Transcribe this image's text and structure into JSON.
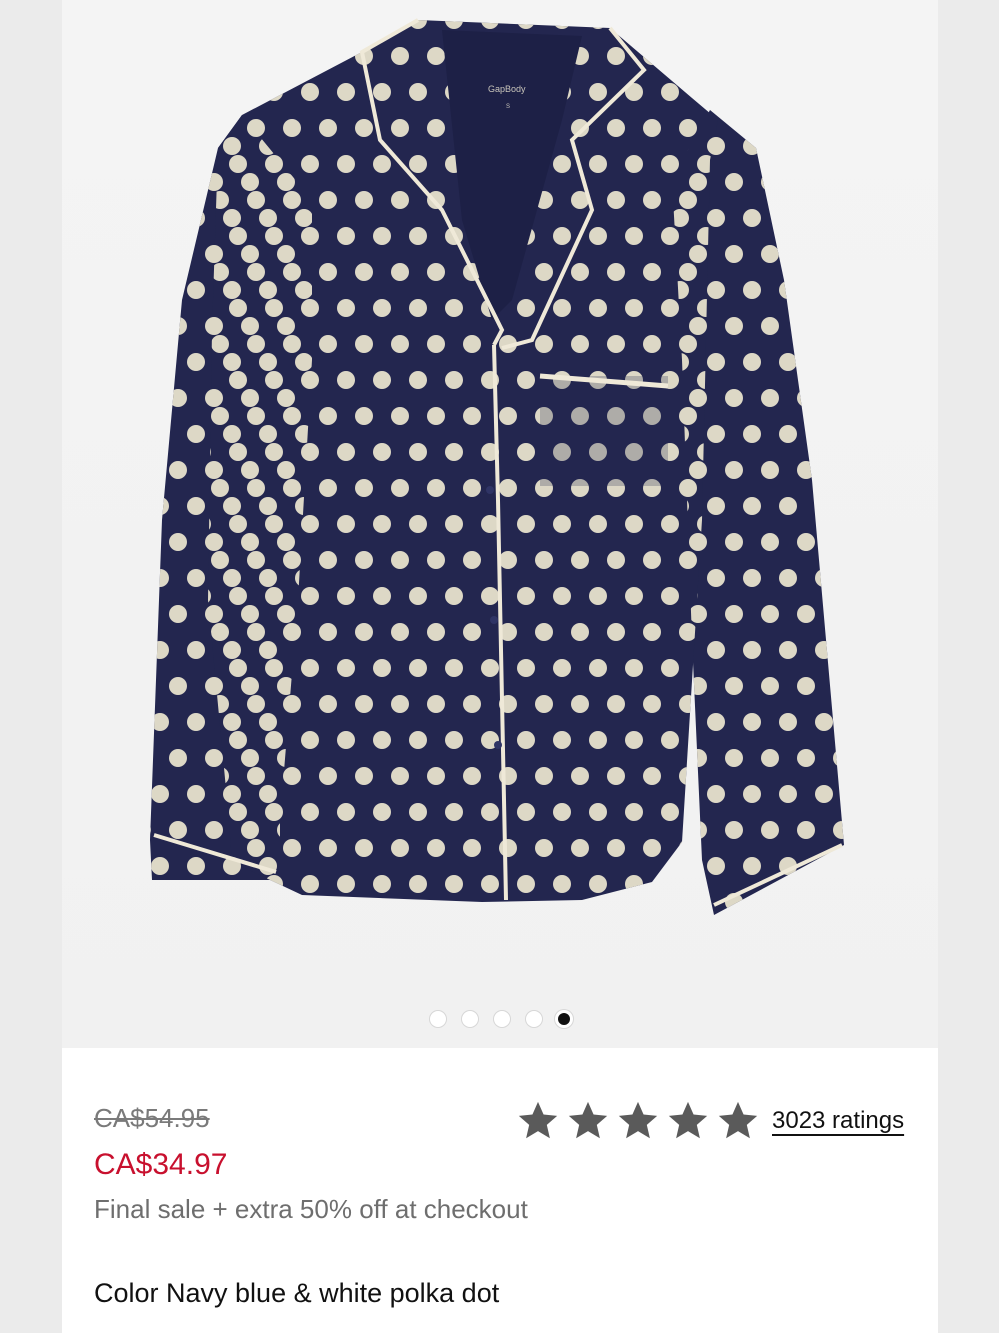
{
  "product": {
    "image_alt": "Navy polka dot pajama shirt",
    "label_brand": "GapBody",
    "label_size": "S",
    "colors": {
      "fabric": "#23264f",
      "dot": "#ddd8c6",
      "piping": "#efe9d8"
    }
  },
  "carousel": {
    "total": 5,
    "active_index": 4
  },
  "pricing": {
    "original": "CA$54.95",
    "sale": "CA$34.97",
    "promo": "Final sale + extra 50% off at checkout",
    "sale_color": "#c8102e"
  },
  "rating": {
    "stars": 5,
    "label": "3023 ratings"
  },
  "color": {
    "label": "Color Navy blue & white polka dot"
  }
}
